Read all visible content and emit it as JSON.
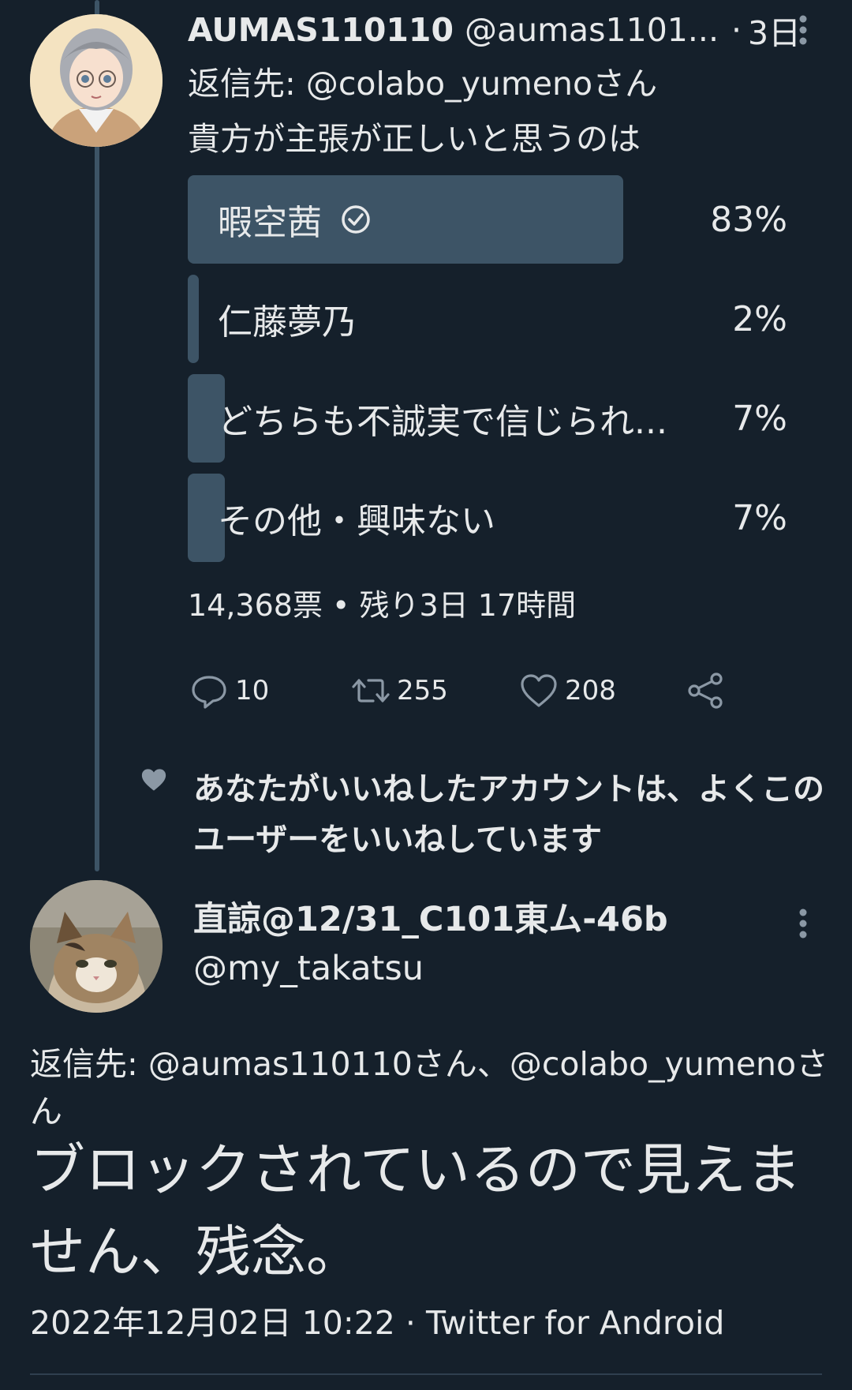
{
  "tweet1": {
    "display_name": "AUMAS110110",
    "handle": "@aumas1101...",
    "separator": "·",
    "time": "3日",
    "reply_to": "返信先: @colabo_yumenoさん",
    "text": "貴方が主張が正しいと思うのは",
    "poll": {
      "options": [
        {
          "label": "暇空茜",
          "percent_text": "83%",
          "percent": 83,
          "selected": true
        },
        {
          "label": "仁藤夢乃",
          "percent_text": "2%",
          "percent": 2,
          "selected": false
        },
        {
          "label": "どちらも不誠実で信じられ...",
          "percent_text": "7%",
          "percent": 7,
          "selected": false
        },
        {
          "label": "その他・興味ない",
          "percent_text": "7%",
          "percent": 7,
          "selected": false
        }
      ],
      "meta": "14,368票 • 残り3日 17時間"
    },
    "actions": {
      "replies": "10",
      "retweets": "255",
      "likes": "208"
    }
  },
  "social_context": "あなたがいいねしたアカウントは、よくこのユーザーをいいねしています",
  "tweet2": {
    "display_name": "直諒@12/31_C101東ム-46b",
    "handle": "@my_takatsu",
    "reply_to": "返信先: @aumas110110さん、@colabo_yumenoさん",
    "text": "ブロックされているので見えません、残念。",
    "timestamp": "2022年12月02日 10:22",
    "separator": "·",
    "source": "Twitter for Android"
  },
  "colors": {
    "background": "#15202b",
    "poll_bar": "#3d5466",
    "text": "#e7e9ea",
    "secondary": "#8b98a5"
  }
}
